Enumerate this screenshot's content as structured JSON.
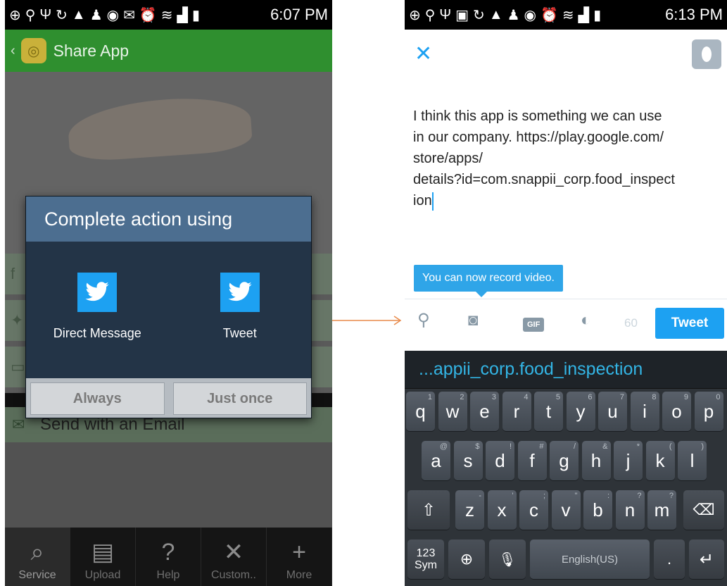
{
  "left": {
    "status_time": "6:07 PM",
    "app_title": "Share App",
    "dialog": {
      "title": "Complete action using",
      "options": [
        "Direct Message",
        "Tweet"
      ],
      "buttons": {
        "always": "Always",
        "just_once": "Just once"
      }
    },
    "email_row": "Send with an Email",
    "bottom_nav": [
      "Service",
      "Upload",
      "Help",
      "Custom..",
      "More"
    ]
  },
  "right": {
    "status_time": "6:13 PM",
    "tweet_text": "I think this app is something we can use in our company. https://play.google.com/store/apps/details?id=com.snappii_corp.food_inspection",
    "tweet_lines": [
      "I think this app is something we can use",
      "in our company. https://play.google.com/",
      "store/apps/",
      "details?id=com.snappii_corp.food_inspect",
      "ion"
    ],
    "tooltip": "You can now record video.",
    "gif_label": "GIF",
    "char_count": "60",
    "tweet_button": "Tweet",
    "suggestion": "...appii_corp.food_inspection",
    "keyboard": {
      "row1": [
        "q",
        "w",
        "e",
        "r",
        "t",
        "y",
        "u",
        "i",
        "o",
        "p"
      ],
      "row1_alt": [
        "1",
        "2",
        "3",
        "4",
        "5",
        "6",
        "7",
        "8",
        "9",
        "0"
      ],
      "row2": [
        "a",
        "s",
        "d",
        "f",
        "g",
        "h",
        "j",
        "k",
        "l"
      ],
      "row2_alt": [
        "@",
        "$",
        "!",
        "#",
        "/",
        "&",
        "*",
        "(",
        ")"
      ],
      "row3": [
        "z",
        "x",
        "c",
        "v",
        "b",
        "n",
        "m"
      ],
      "row3_alt": [
        "-",
        "'",
        ";",
        "\"",
        ":",
        "?",
        "?"
      ],
      "sym_label": "123\nSym",
      "space_label": "English(US)"
    }
  },
  "colors": {
    "twitter_blue": "#1da1f2",
    "app_green": "#2f8f2f",
    "dialog_title": "#4c6e90",
    "arrow": "#e88a4a"
  }
}
